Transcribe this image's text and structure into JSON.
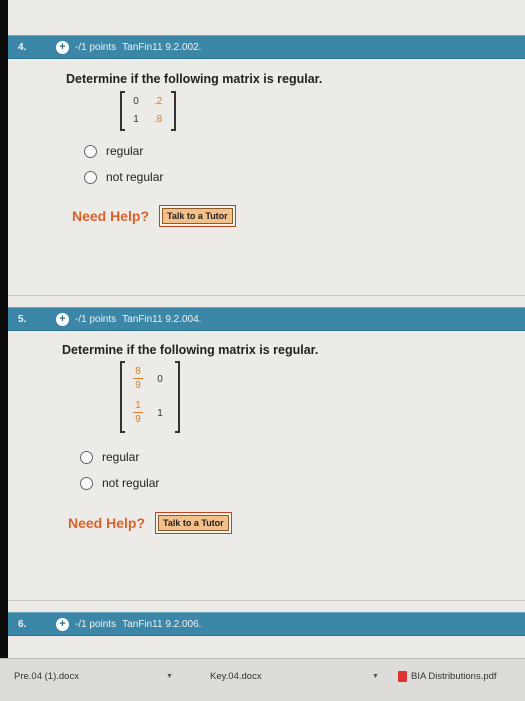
{
  "q4": {
    "header": {
      "number": "4.",
      "points": "-/1 points",
      "code": "TanFin11 9.2.002."
    },
    "title": "Determine if the following matrix is regular.",
    "matrix": [
      [
        "0",
        ".2"
      ],
      [
        "1",
        ".8"
      ]
    ],
    "options": [
      "regular",
      "not regular"
    ],
    "need_help": "Need Help?",
    "tutor_button": "Talk to a Tutor"
  },
  "q5": {
    "header": {
      "number": "5.",
      "points": "-/1 points",
      "code": "TanFin11 9.2.004."
    },
    "title": "Determine if the following matrix is regular.",
    "matrix": {
      "r1c1": {
        "num": "8",
        "den": "9"
      },
      "r1c2": "0",
      "r2c1": {
        "num": "1",
        "den": "9"
      },
      "r2c2": "1"
    },
    "options": [
      "regular",
      "not regular"
    ],
    "need_help": "Need Help?",
    "tutor_button": "Talk to a Tutor"
  },
  "q6": {
    "header": {
      "number": "6.",
      "points": "-/1 points",
      "code": "TanFin11 9.2.006."
    }
  },
  "downloads": [
    {
      "name": "Pre.04 (1).docx"
    },
    {
      "name": "Key.04.docx"
    },
    {
      "name": "BIA Distributions.pdf"
    }
  ],
  "colors": {
    "header": "#3c87a8",
    "need_help": "#d9622a",
    "tutor": "#f4c089"
  }
}
